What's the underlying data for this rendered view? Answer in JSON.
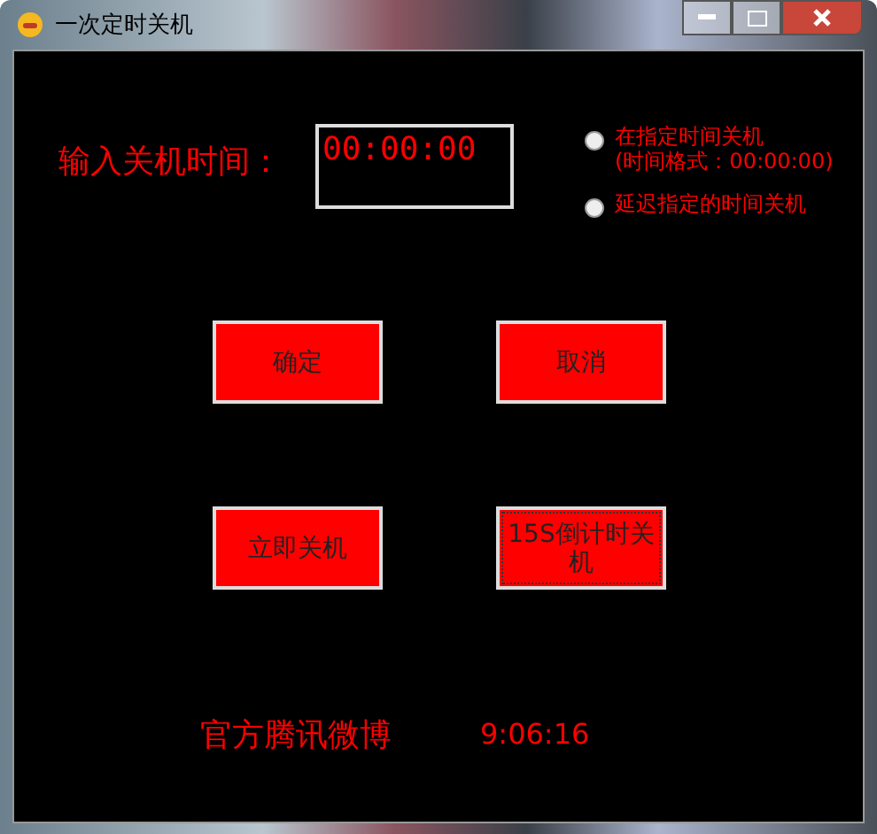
{
  "window": {
    "title": "一次定时关机"
  },
  "time_input": {
    "label": "输入关机时间：",
    "value": "00:00:00"
  },
  "modes": [
    {
      "label": "在指定时间关机",
      "hint": "(时间格式：00:00:00)",
      "selected": false
    },
    {
      "label": "延迟指定的时间关机",
      "selected": false
    }
  ],
  "buttons": [
    {
      "label": "确定",
      "focused": false
    },
    {
      "label": "取消",
      "focused": false
    },
    {
      "label": "立即关机",
      "focused": false
    },
    {
      "label": "15S倒计时关机",
      "focused": true
    }
  ],
  "footer": {
    "link": "官方腾讯微博",
    "clock": "9:06:16"
  }
}
